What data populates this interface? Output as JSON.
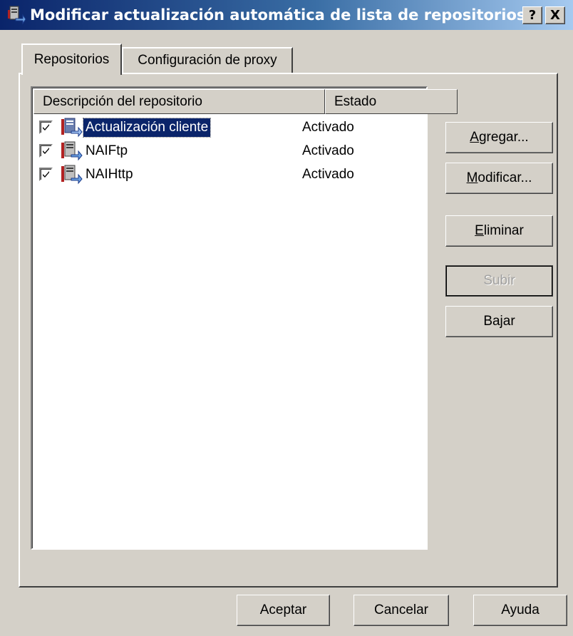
{
  "window": {
    "title": "Modificar actualización automática de lista de repositorios",
    "help_button": "?",
    "close_button": "X"
  },
  "tabs": [
    {
      "label": "Repositorios",
      "active": true
    },
    {
      "label": "Configuración de proxy",
      "active": false
    }
  ],
  "list": {
    "columns": [
      "Descripción del repositorio",
      "Estado"
    ],
    "rows": [
      {
        "name": "Actualización cliente",
        "status": "Activado",
        "checked": true,
        "selected": true,
        "icon": "repository-icon"
      },
      {
        "name": "NAIFtp",
        "status": "Activado",
        "checked": true,
        "selected": false,
        "icon": "repository-icon"
      },
      {
        "name": "NAIHttp",
        "status": "Activado",
        "checked": true,
        "selected": false,
        "icon": "repository-icon"
      }
    ]
  },
  "side_buttons": {
    "agregar": {
      "accel": "A",
      "rest": "gregar..."
    },
    "modificar": {
      "accel": "M",
      "rest": "odificar..."
    },
    "eliminar": {
      "accel": "E",
      "rest": "liminar"
    },
    "subir": {
      "label": "Subir",
      "disabled": true
    },
    "bajar": {
      "label": "Bajar"
    }
  },
  "footer_buttons": {
    "aceptar": "Aceptar",
    "cancelar": "Cancelar",
    "ayuda": "Ayuda"
  },
  "colors": {
    "titlebar_start": "#0a246a",
    "titlebar_end": "#a6caf0",
    "selection": "#0a246a",
    "face": "#d4d0c8"
  }
}
